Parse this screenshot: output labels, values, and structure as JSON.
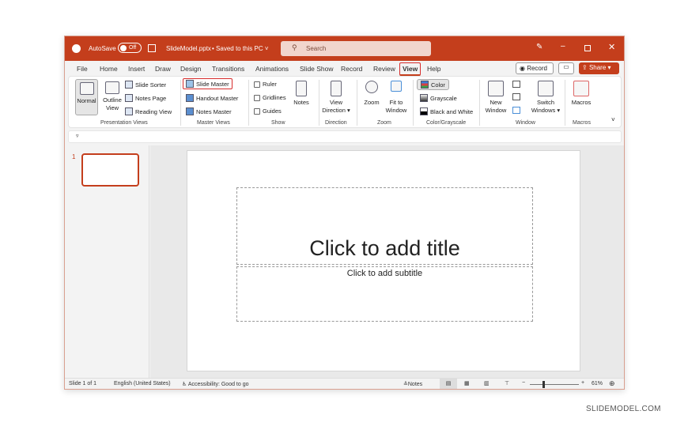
{
  "titlebar": {
    "autosave_label": "AutoSave",
    "autosave_state": "Off",
    "filename": "SlideModel.pptx",
    "saved_status": "Saved to this PC",
    "search_placeholder": "Search"
  },
  "tabs": [
    "File",
    "Home",
    "Insert",
    "Draw",
    "Design",
    "Transitions",
    "Animations",
    "Slide Show",
    "Record",
    "Review",
    "View",
    "Help"
  ],
  "active_tab": "View",
  "actions": {
    "record": "Record",
    "share": "Share"
  },
  "ribbon": {
    "presentation_views": {
      "label": "Presentation Views",
      "normal": "Normal",
      "outline": "Outline View",
      "slide_sorter": "Slide Sorter",
      "notes_page": "Notes Page",
      "reading_view": "Reading View"
    },
    "master_views": {
      "label": "Master Views",
      "slide_master": "Slide Master",
      "handout_master": "Handout Master",
      "notes_master": "Notes Master"
    },
    "show": {
      "label": "Show",
      "ruler": "Ruler",
      "gridlines": "Gridlines",
      "guides": "Guides",
      "notes": "Notes"
    },
    "direction": {
      "label": "Direction",
      "view_direction": "View Direction"
    },
    "zoom": {
      "label": "Zoom",
      "zoom": "Zoom",
      "fit": "Fit to Window"
    },
    "color": {
      "label": "Color/Grayscale",
      "color": "Color",
      "grayscale": "Grayscale",
      "bw": "Black and White"
    },
    "window": {
      "label": "Window",
      "new_window": "New Window",
      "switch": "Switch Windows"
    },
    "macros": {
      "label": "Macros",
      "macros": "Macros"
    }
  },
  "thumbnail_number": "1",
  "slide": {
    "title_placeholder": "Click to add title",
    "subtitle_placeholder": "Click to add subtitle"
  },
  "status": {
    "slide": "Slide 1 of 1",
    "language": "English (United States)",
    "accessibility": "Accessibility: Good to go",
    "notes": "Notes",
    "zoom": "61%"
  },
  "watermark": "SLIDEMODEL.COM"
}
